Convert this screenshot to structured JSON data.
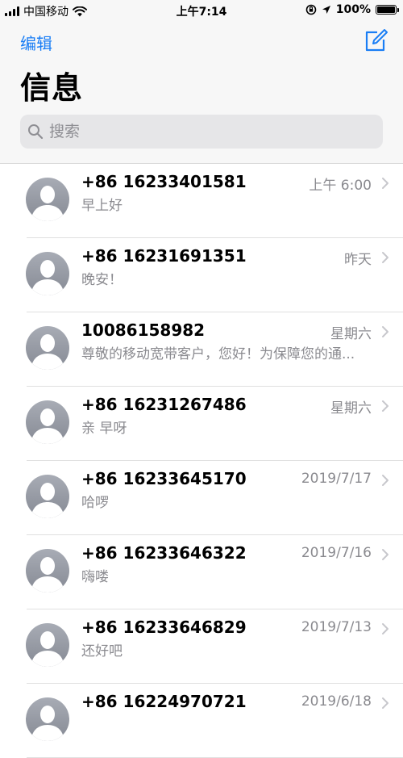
{
  "status_bar": {
    "carrier": "中国移动",
    "time": "上午7:14",
    "battery_percent": "100%",
    "battery_level": 1.0,
    "icons": [
      "signal-icon",
      "wifi-icon",
      "rotation-lock-icon",
      "location-icon",
      "battery-icon"
    ]
  },
  "nav": {
    "edit_label": "编辑",
    "title": "信息",
    "compose_icon": "compose-icon"
  },
  "search": {
    "placeholder": "搜索",
    "icon": "search-icon"
  },
  "accent_color": "#1a7ef5",
  "messages": [
    {
      "sender": "+86 16233401581",
      "preview": "早上好",
      "time": "上午 6:00"
    },
    {
      "sender": "+86 16231691351",
      "preview": "晚安！",
      "time": "昨天"
    },
    {
      "sender": "10086158982",
      "preview": "尊敬的移动宽带客户，您好！为保障您的通...",
      "time": "星期六"
    },
    {
      "sender": "+86 16231267486",
      "preview": "亲 早呀",
      "time": "星期六"
    },
    {
      "sender": "+86 16233645170",
      "preview": "哈啰",
      "time": "2019/7/17"
    },
    {
      "sender": "+86 16233646322",
      "preview": "嗨喽",
      "time": "2019/7/16"
    },
    {
      "sender": "+86 16233646829",
      "preview": "还好吧",
      "time": "2019/7/13"
    },
    {
      "sender": "+86 16224970721",
      "preview": "",
      "time": "2019/6/18"
    }
  ]
}
